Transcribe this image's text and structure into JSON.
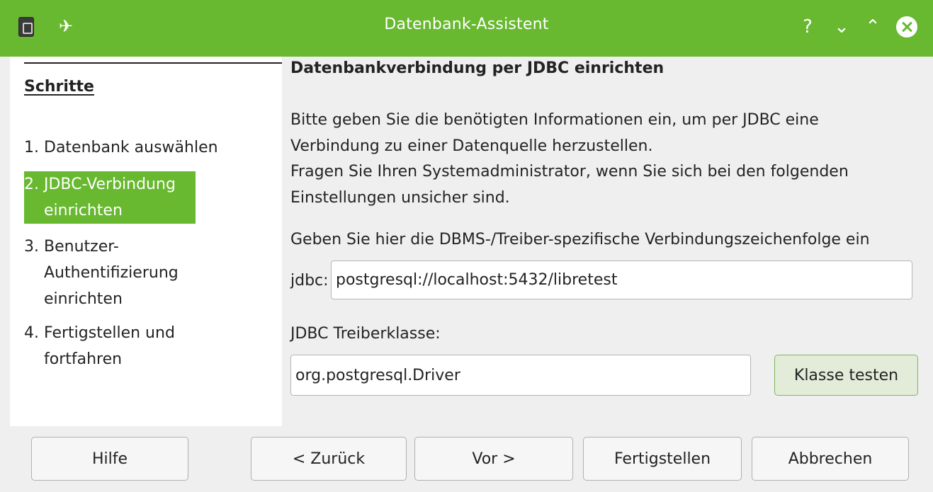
{
  "window": {
    "title": "Datenbank-Assistent",
    "help_glyph": "?",
    "min_glyph": "⌄",
    "max_glyph": "⌃",
    "pin_glyph": "✈"
  },
  "roadmap": {
    "heading": "Schritte",
    "steps": [
      {
        "num": "1.",
        "label": "Datenbank auswählen"
      },
      {
        "num": "2.",
        "label": "JDBC-Verbindung\neinrichten"
      },
      {
        "num": "3.",
        "label": "Benutzer-\nAuthentifizierung\neinrichten"
      },
      {
        "num": "4.",
        "label": "Fertigstellen und\nfortfahren"
      }
    ],
    "active_step": 2
  },
  "page": {
    "title": "Datenbankverbindung per JDBC einrichten",
    "description": "Bitte geben Sie die benötigten Informationen ein, um per JDBC eine\nVerbindung zu einer Datenquelle herzustellen.\nFragen Sie Ihren Systemadministrator, wenn Sie sich bei den folgenden\nEinstellungen unsicher sind.",
    "connection_label": "Geben Sie hier die DBMS-/Treiber-spezifische Verbindungszeichenfolge ein",
    "jdbc_prefix": "jdbc:",
    "connection_value": "postgresql://localhost:5432/libretest",
    "driver_label": "JDBC Treiberklasse:",
    "driver_value": "org.postgresql.Driver",
    "test_button": "Klasse testen"
  },
  "footer": {
    "help": "Hilfe",
    "back": "< Zurück",
    "next": "Vor >",
    "finish": "Fertigstellen",
    "cancel": "Abbrechen"
  },
  "colors": {
    "accent": "#68b830",
    "window_bg": "#efefef",
    "panel_bg": "#ffffff"
  }
}
